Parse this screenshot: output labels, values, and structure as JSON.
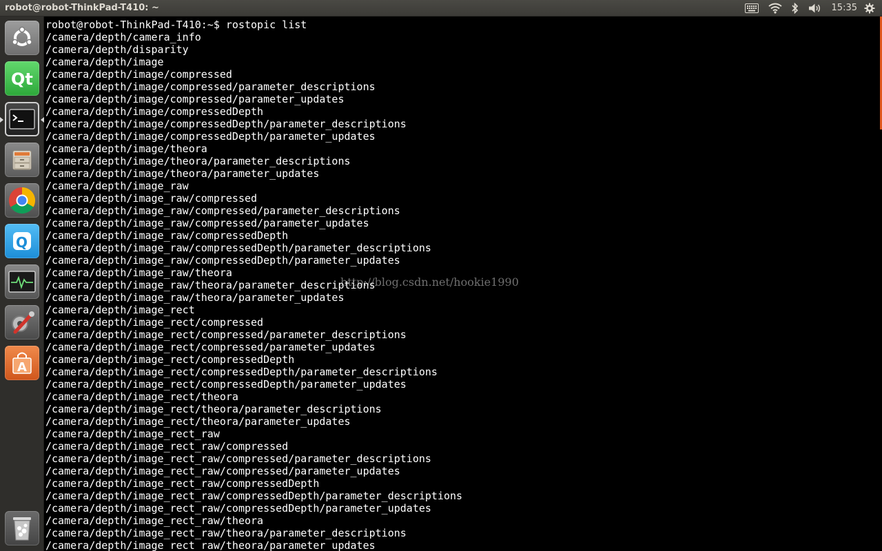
{
  "top_panel": {
    "window_title": "robot@robot-ThinkPad-T410: ~",
    "indicators": {
      "keyboard": "keyboard-icon",
      "network": "wifi-icon",
      "bluetooth": "bluetooth-icon",
      "sound": "volume-icon",
      "session": "gear-icon"
    },
    "clock": "15:35"
  },
  "launcher": {
    "items": [
      {
        "name": "dash-home",
        "icon": "ubuntu-logo-icon",
        "color": "#8a8a8a"
      },
      {
        "name": "qt-creator",
        "icon": "qt-icon",
        "color": "#41cd52"
      },
      {
        "name": "terminal",
        "icon": "terminal-icon",
        "color": "#2c2c2c"
      },
      {
        "name": "files",
        "icon": "file-cabinet-icon",
        "color": "#cfc7b8"
      },
      {
        "name": "chrome",
        "icon": "chrome-icon",
        "color": "#4285f4"
      },
      {
        "name": "qq",
        "icon": "qq-icon",
        "color": "#2fa3e8"
      },
      {
        "name": "system-monitor",
        "icon": "system-monitor-icon",
        "color": "#3a3a3a"
      },
      {
        "name": "system-settings",
        "icon": "settings-tools-icon",
        "color": "#5d5d5d"
      },
      {
        "name": "software-center",
        "icon": "shopping-bag-icon",
        "color": "#e3662a"
      },
      {
        "name": "trash",
        "icon": "trash-icon",
        "color": "#9a9a9a"
      }
    ]
  },
  "terminal": {
    "lines": [
      "robot@robot-ThinkPad-T410:~$ rostopic list",
      "/camera/depth/camera_info",
      "/camera/depth/disparity",
      "/camera/depth/image",
      "/camera/depth/image/compressed",
      "/camera/depth/image/compressed/parameter_descriptions",
      "/camera/depth/image/compressed/parameter_updates",
      "/camera/depth/image/compressedDepth",
      "/camera/depth/image/compressedDepth/parameter_descriptions",
      "/camera/depth/image/compressedDepth/parameter_updates",
      "/camera/depth/image/theora",
      "/camera/depth/image/theora/parameter_descriptions",
      "/camera/depth/image/theora/parameter_updates",
      "/camera/depth/image_raw",
      "/camera/depth/image_raw/compressed",
      "/camera/depth/image_raw/compressed/parameter_descriptions",
      "/camera/depth/image_raw/compressed/parameter_updates",
      "/camera/depth/image_raw/compressedDepth",
      "/camera/depth/image_raw/compressedDepth/parameter_descriptions",
      "/camera/depth/image_raw/compressedDepth/parameter_updates",
      "/camera/depth/image_raw/theora",
      "/camera/depth/image_raw/theora/parameter_descriptions",
      "/camera/depth/image_raw/theora/parameter_updates",
      "/camera/depth/image_rect",
      "/camera/depth/image_rect/compressed",
      "/camera/depth/image_rect/compressed/parameter_descriptions",
      "/camera/depth/image_rect/compressed/parameter_updates",
      "/camera/depth/image_rect/compressedDepth",
      "/camera/depth/image_rect/compressedDepth/parameter_descriptions",
      "/camera/depth/image_rect/compressedDepth/parameter_updates",
      "/camera/depth/image_rect/theora",
      "/camera/depth/image_rect/theora/parameter_descriptions",
      "/camera/depth/image_rect/theora/parameter_updates",
      "/camera/depth/image_rect_raw",
      "/camera/depth/image_rect_raw/compressed",
      "/camera/depth/image_rect_raw/compressed/parameter_descriptions",
      "/camera/depth/image_rect_raw/compressed/parameter_updates",
      "/camera/depth/image_rect_raw/compressedDepth",
      "/camera/depth/image_rect_raw/compressedDepth/parameter_descriptions",
      "/camera/depth/image_rect_raw/compressedDepth/parameter_updates",
      "/camera/depth/image_rect_raw/theora",
      "/camera/depth/image_rect_raw/theora/parameter_descriptions",
      "/camera/depth/image_rect_raw/theora/parameter_updates"
    ],
    "watermark": "http://blog.csdn.net/hookie1990",
    "scrollbar_color": "#e0581e"
  }
}
